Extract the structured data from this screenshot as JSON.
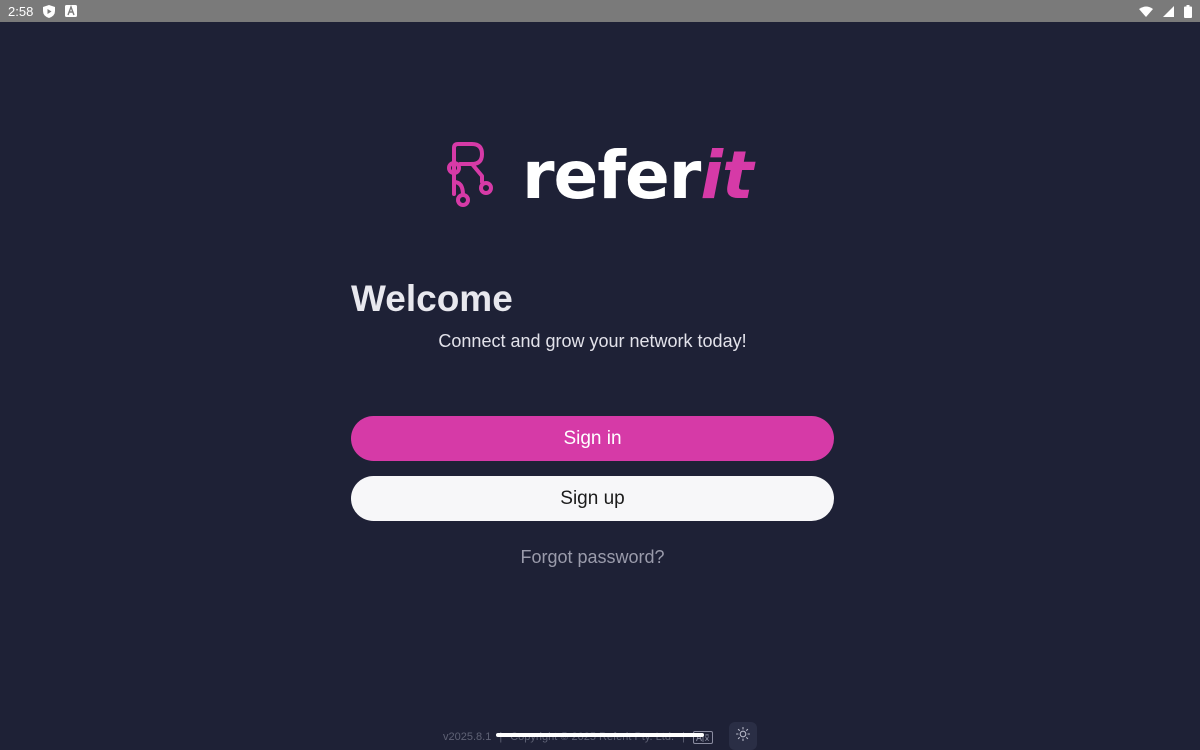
{
  "status_bar": {
    "time": "2:58",
    "left_icons": [
      "shield-play-icon",
      "a-letter-icon"
    ],
    "right_icons": [
      "wifi-icon",
      "signal-icon",
      "battery-icon"
    ]
  },
  "logo": {
    "icon": "referit-logo-icon",
    "text_main": "refer",
    "text_accent": "it"
  },
  "welcome": {
    "title": "Welcome",
    "tagline": "Connect and grow your network today!"
  },
  "actions": {
    "sign_in_label": "Sign in",
    "sign_up_label": "Sign up",
    "forgot_password_label": "Forgot password?"
  },
  "footer": {
    "version": "v2025.8.1",
    "separator": "|",
    "copyright": "Copyright © 2025 Referit Pty. Ltd.",
    "language_icon": "language-icon",
    "theme_icon": "sun-icon"
  },
  "colors": {
    "background": "#1e2136",
    "accent": "#d63aa7",
    "sign_up_bg": "#f7f7f9"
  }
}
